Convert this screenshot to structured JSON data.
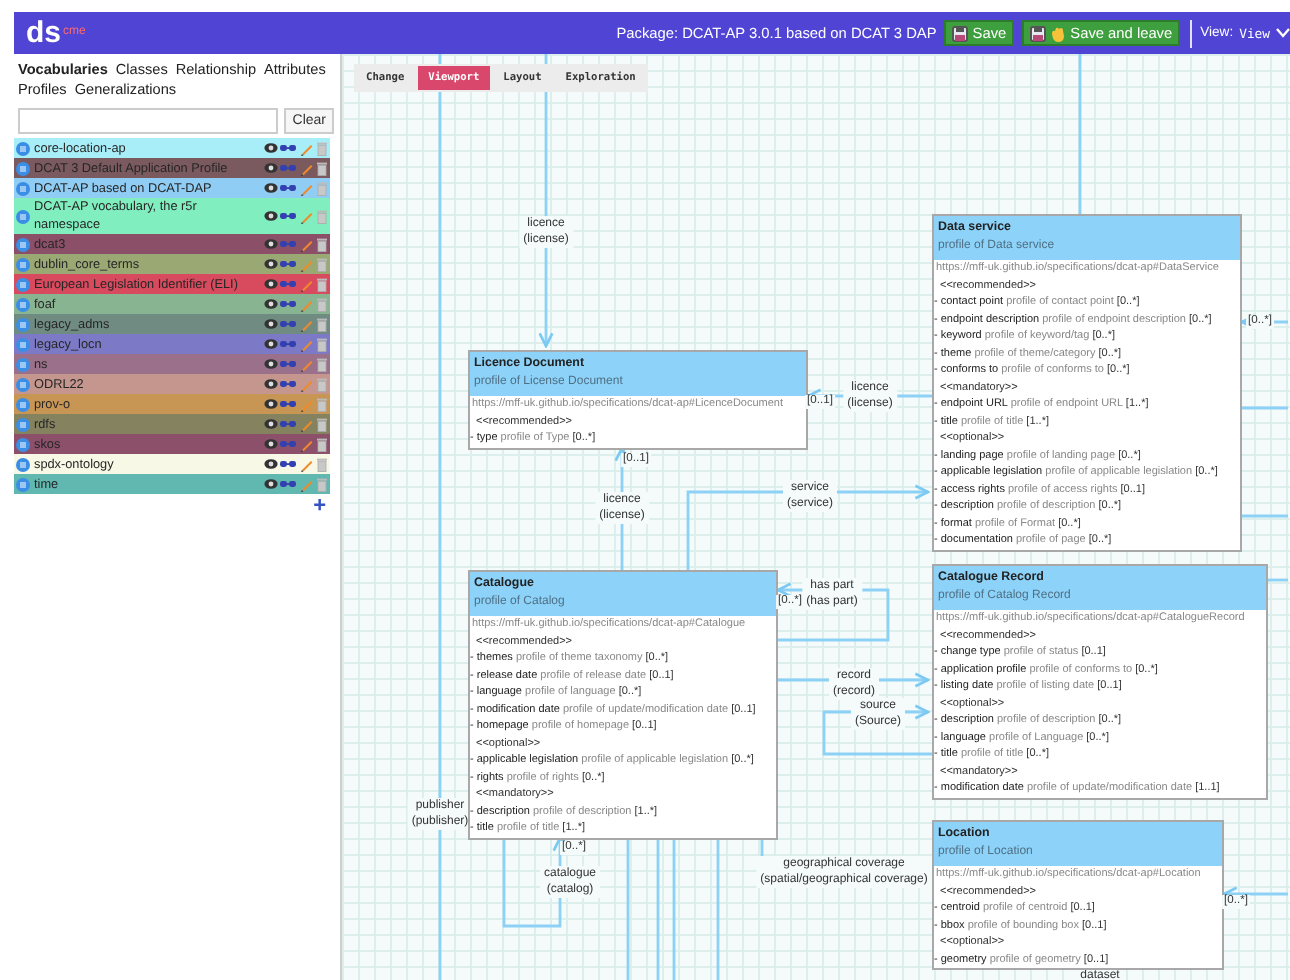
{
  "header": {
    "logo": "ds",
    "logo_sup": "cme",
    "package": "Package: DCAT-AP 3.0.1 based on DCAT 3 DAP",
    "buttons": [
      {
        "label": "Save",
        "kind": "save"
      },
      {
        "label": "Save and leave",
        "kind": "leave"
      }
    ],
    "view_label": "View:",
    "view_value": "View"
  },
  "sidebar": {
    "tabs": [
      {
        "label": "Vocabularies",
        "selected": true
      },
      {
        "label": "Classes",
        "selected": false
      },
      {
        "label": "Relationship",
        "selected": false
      },
      {
        "label": "Attributes",
        "selected": false
      },
      {
        "label": "Profiles",
        "selected": false
      },
      {
        "label": "Generalizations",
        "selected": false
      }
    ],
    "clear_button": "Clear",
    "vocabularies": [
      {
        "name": "core-location-ap",
        "color": "#a8eef8"
      },
      {
        "name": "DCAT 3 Default Application Profile",
        "color": "#7a5a5e"
      },
      {
        "name": "DCAT-AP based on DCAT-DAP",
        "color": "#90cdf4"
      },
      {
        "name": "DCAT-AP vocabulary, the r5r namespace",
        "color": "#80eebe"
      },
      {
        "name": "dcat3",
        "color": "#8c4f68"
      },
      {
        "name": "dublin_core_terms",
        "color": "#9aa874"
      },
      {
        "name": "European Legislation Identifier (ELI)",
        "color": "#d84a5e"
      },
      {
        "name": "foaf",
        "color": "#88b492"
      },
      {
        "name": "legacy_adms",
        "color": "#708c82"
      },
      {
        "name": "legacy_locn",
        "color": "#7c7ac6"
      },
      {
        "name": "ns",
        "color": "#9a708a"
      },
      {
        "name": "ODRL22",
        "color": "#c4968e"
      },
      {
        "name": "prov-o",
        "color": "#c89654"
      },
      {
        "name": "rdfs",
        "color": "#84825f"
      },
      {
        "name": "skos",
        "color": "#8c506a"
      },
      {
        "name": "spdx-ontology",
        "color": "#f8f8e6"
      },
      {
        "name": "time",
        "color": "#60b8b0"
      }
    ],
    "add_button": "+"
  },
  "canvas": {
    "toolbar": [
      {
        "label": "Change",
        "selected": false
      },
      {
        "label": "Viewport",
        "selected": true
      },
      {
        "label": "Layout",
        "selected": false
      },
      {
        "label": "Exploration",
        "selected": false
      }
    ],
    "nodes": [
      {
        "title": "Data service",
        "subtitle": "profile of Data service",
        "iri": "https://mff-uk.github.io/specifications/dcat-ap#DataService",
        "rows": [
          {
            "kind": "stereotype",
            "text": "<<recommended>>"
          },
          {
            "kind": "attribute",
            "name": "- contact point",
            "type": "profile of contact point",
            "cardinality": "[0..*]"
          },
          {
            "kind": "attribute",
            "name": "- endpoint description",
            "type": "profile of endpoint description",
            "cardinality": "[0..*]"
          },
          {
            "kind": "attribute",
            "name": "- keyword",
            "type": "profile of keyword/tag",
            "cardinality": "[0..*]"
          },
          {
            "kind": "attribute",
            "name": "- theme",
            "type": "profile of theme/category",
            "cardinality": "[0..*]"
          },
          {
            "kind": "attribute",
            "name": "- conforms to",
            "type": "profile of conforms to",
            "cardinality": "[0..*]"
          },
          {
            "kind": "stereotype",
            "text": "<<mandatory>>"
          },
          {
            "kind": "attribute",
            "name": "- endpoint URL",
            "type": "profile of endpoint URL",
            "cardinality": "[1..*]"
          },
          {
            "kind": "attribute",
            "name": "- title",
            "type": "profile of title",
            "cardinality": "[1..*]"
          },
          {
            "kind": "stereotype",
            "text": "<<optional>>"
          },
          {
            "kind": "attribute",
            "name": "- landing page",
            "type": "profile of landing page",
            "cardinality": "[0..*]"
          },
          {
            "kind": "attribute",
            "name": "- applicable legislation",
            "type": "profile of applicable legislation",
            "cardinality": "[0..*]"
          },
          {
            "kind": "attribute",
            "name": "- access rights",
            "type": "profile of access rights",
            "cardinality": "[0..1]"
          },
          {
            "kind": "attribute",
            "name": "- description",
            "type": "profile of description",
            "cardinality": "[0..*]"
          },
          {
            "kind": "attribute",
            "name": "- format",
            "type": "profile of Format",
            "cardinality": "[0..*]"
          },
          {
            "kind": "attribute",
            "name": "- documentation",
            "type": "profile of page",
            "cardinality": "[0..*]"
          }
        ]
      },
      {
        "title": "Licence Document",
        "subtitle": "profile of License Document",
        "iri": "https://mff-uk.github.io/specifications/dcat-ap#LicenceDocument",
        "rows": [
          {
            "kind": "stereotype",
            "text": "<<recommended>>"
          },
          {
            "kind": "attribute",
            "name": "- type",
            "type": "profile of Type",
            "cardinality": "[0..*]"
          }
        ]
      },
      {
        "title": "Catalogue",
        "subtitle": "profile of Catalog",
        "iri": "https://mff-uk.github.io/specifications/dcat-ap#Catalogue",
        "rows": [
          {
            "kind": "stereotype",
            "text": "<<recommended>>"
          },
          {
            "kind": "attribute",
            "name": "- themes",
            "type": "profile of theme taxonomy",
            "cardinality": "[0..*]"
          },
          {
            "kind": "attribute",
            "name": "- release date",
            "type": "profile of release date",
            "cardinality": "[0..1]"
          },
          {
            "kind": "attribute",
            "name": "- language",
            "type": "profile of language",
            "cardinality": "[0..*]"
          },
          {
            "kind": "attribute",
            "name": "- modification date",
            "type": "profile of update/modification date",
            "cardinality": "[0..1]"
          },
          {
            "kind": "attribute",
            "name": "- homepage",
            "type": "profile of homepage",
            "cardinality": "[0..1]"
          },
          {
            "kind": "stereotype",
            "text": "<<optional>>"
          },
          {
            "kind": "attribute",
            "name": "- applicable legislation",
            "type": "profile of applicable legislation",
            "cardinality": "[0..*]"
          },
          {
            "kind": "attribute",
            "name": "- rights",
            "type": "profile of rights",
            "cardinality": "[0..*]"
          },
          {
            "kind": "stereotype",
            "text": "<<mandatory>>"
          },
          {
            "kind": "attribute",
            "name": "- description",
            "type": "profile of description",
            "cardinality": "[1..*]"
          },
          {
            "kind": "attribute",
            "name": "- title",
            "type": "profile of title",
            "cardinality": "[1..*]"
          }
        ]
      },
      {
        "title": "Catalogue Record",
        "subtitle": "profile of Catalog Record",
        "iri": "https://mff-uk.github.io/specifications/dcat-ap#CatalogueRecord",
        "rows": [
          {
            "kind": "stereotype",
            "text": "<<recommended>>"
          },
          {
            "kind": "attribute",
            "name": "- change type",
            "type": "profile of status",
            "cardinality": "[0..1]"
          },
          {
            "kind": "attribute",
            "name": "- application profile",
            "type": "profile of conforms to",
            "cardinality": "[0..*]"
          },
          {
            "kind": "attribute",
            "name": "- listing date",
            "type": "profile of listing date",
            "cardinality": "[0..1]"
          },
          {
            "kind": "stereotype",
            "text": "<<optional>>"
          },
          {
            "kind": "attribute",
            "name": "- description",
            "type": "profile of description",
            "cardinality": "[0..*]"
          },
          {
            "kind": "attribute",
            "name": "- language",
            "type": "profile of Language",
            "cardinality": "[0..*]"
          },
          {
            "kind": "attribute",
            "name": "- title",
            "type": "profile of title",
            "cardinality": "[0..*]"
          },
          {
            "kind": "stereotype",
            "text": "<<mandatory>>"
          },
          {
            "kind": "attribute",
            "name": "- modification date",
            "type": "profile of update/modification date",
            "cardinality": "[1..1]"
          }
        ]
      },
      {
        "title": "Location",
        "subtitle": "profile of Location",
        "iri": "https://mff-uk.github.io/specifications/dcat-ap#Location",
        "rows": [
          {
            "kind": "stereotype",
            "text": "<<recommended>>"
          },
          {
            "kind": "attribute",
            "name": "- centroid",
            "type": "profile of centroid",
            "cardinality": "[0..1]"
          },
          {
            "kind": "attribute",
            "name": "- bbox",
            "type": "profile of bounding box",
            "cardinality": "[0..1]"
          },
          {
            "kind": "stereotype",
            "text": "<<optional>>"
          },
          {
            "kind": "attribute",
            "name": "- geometry",
            "type": "profile of geometry",
            "cardinality": "[0..1]"
          }
        ]
      }
    ],
    "edge_labels": [
      {
        "lines": [
          "licence",
          "(license)"
        ]
      },
      {
        "lines": [
          "licence",
          "(license)"
        ]
      },
      {
        "lines": [
          "licence",
          "(license)"
        ]
      },
      {
        "lines": [
          "service",
          "(service)"
        ]
      },
      {
        "lines": [
          "has part",
          "(has part)"
        ]
      },
      {
        "lines": [
          "record",
          "(record)"
        ]
      },
      {
        "lines": [
          "source",
          "(Source)"
        ]
      },
      {
        "lines": [
          "publisher",
          "(publisher)"
        ]
      },
      {
        "lines": [
          "catalogue",
          "(catalog)"
        ]
      },
      {
        "lines": [
          "geographical coverage",
          "(spatial/geographical coverage)"
        ]
      },
      {
        "lines": [
          "dataset"
        ]
      }
    ],
    "cardinalities": [
      "[0..1]",
      "[0..1]",
      "[0..*]",
      "[0..*]",
      "[0..*]",
      "[0..*]"
    ]
  }
}
